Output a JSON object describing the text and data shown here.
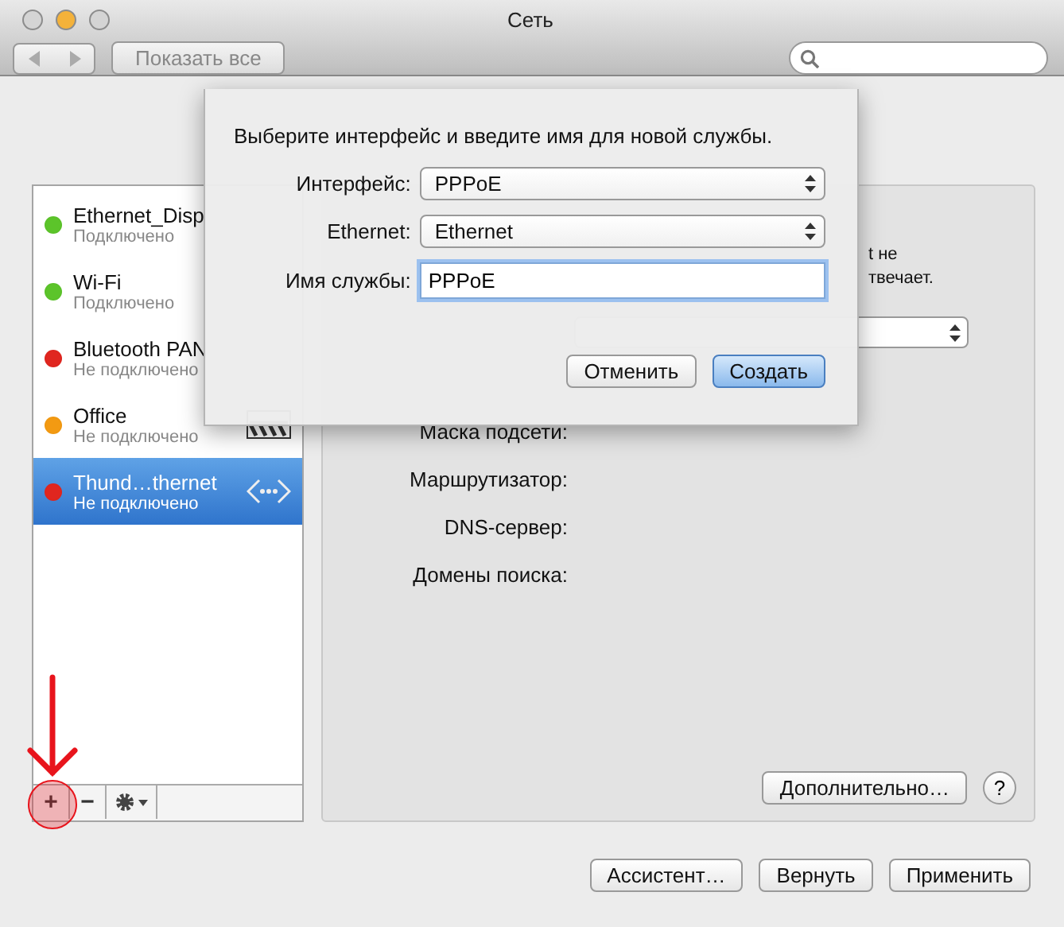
{
  "window": {
    "title": "Сеть"
  },
  "toolbar": {
    "show_all": "Показать все"
  },
  "services": [
    {
      "name": "Ethernet_Disp",
      "status": "Подключено",
      "color": "#5cc42a",
      "selected": false
    },
    {
      "name": "Wi-Fi",
      "status": "Подключено",
      "color": "#5cc42a",
      "selected": false
    },
    {
      "name": "Bluetooth PAN",
      "status": "Не подключено",
      "color": "#e0261f",
      "selected": false
    },
    {
      "name": "Office",
      "status": "Не подключено",
      "color": "#f39a12",
      "selected": false
    },
    {
      "name": "Thund…thernet",
      "status": "Не подключено",
      "color": "#e0261f",
      "selected": true
    }
  ],
  "list_actions": [
    "+",
    "−"
  ],
  "detail": {
    "status_fragments": [
      "t не",
      "твечает."
    ],
    "fields": [
      "Маска подсети:",
      "Маршрутизатор:",
      "DNS-сервер:",
      "Домены поиска:"
    ],
    "advanced_button": "Дополнительно…",
    "help": "?"
  },
  "buttons": [
    "Ассистент…",
    "Вернуть",
    "Применить"
  ],
  "sheet": {
    "prompt": "Выберите интерфейс и введите имя для новой службы.",
    "rows": [
      {
        "kind": "popup",
        "label": "Интерфейс:",
        "value": "PPPoE"
      },
      {
        "kind": "popup",
        "label": "Ethernet:",
        "value": "Ethernet"
      },
      {
        "kind": "text",
        "label": "Имя службы:",
        "value": "PPPoE"
      }
    ],
    "buttons": [
      {
        "label": "Отменить",
        "default": false
      },
      {
        "label": "Создать",
        "default": true
      }
    ]
  }
}
